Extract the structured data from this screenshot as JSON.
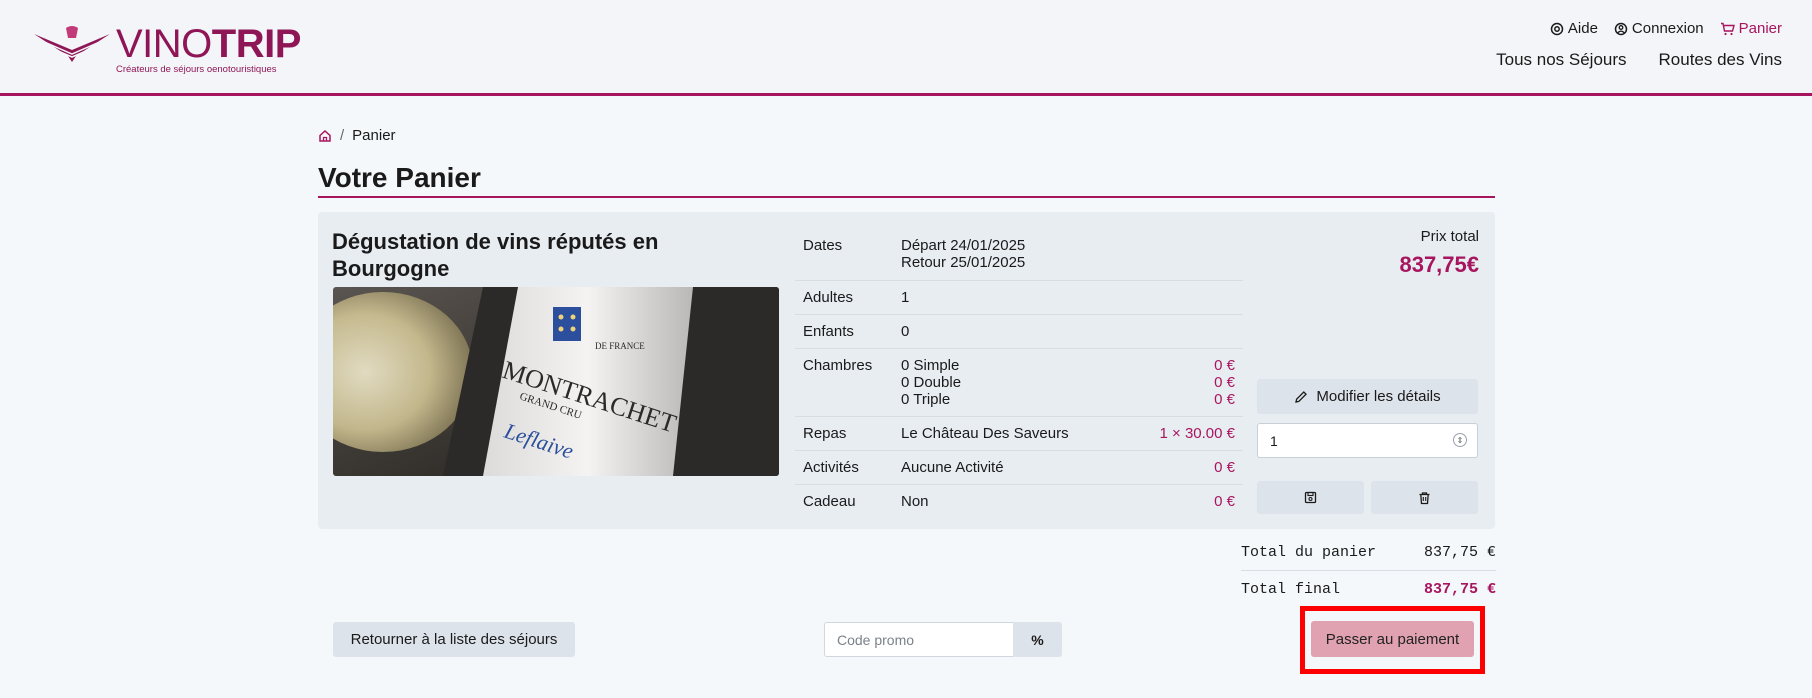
{
  "logo": {
    "word_light": "VINO",
    "word_bold": "TRIP",
    "tagline": "Créateurs de séjours oenotouristiques"
  },
  "topnav": {
    "help": "Aide",
    "login": "Connexion",
    "cart": "Panier"
  },
  "mainnav": {
    "stays": "Tous nos Séjours",
    "routes": "Routes des Vins"
  },
  "breadcrumb": {
    "current": "Panier"
  },
  "page": {
    "title": "Votre Panier"
  },
  "item": {
    "title": "Dégustation de vins réputés en Bourgogne",
    "image_alt": "MONTRACHET GRAND CRU",
    "details": [
      {
        "label": "Dates",
        "lines": [
          "Départ 24/01/2025",
          "Retour 25/01/2025"
        ],
        "prices": []
      },
      {
        "label": "Adultes",
        "lines": [
          "1"
        ],
        "prices": []
      },
      {
        "label": "Enfants",
        "lines": [
          "0"
        ],
        "prices": []
      },
      {
        "label": "Chambres",
        "lines": [
          "0 Simple",
          "0 Double",
          "0 Triple"
        ],
        "prices": [
          "0 €",
          "0 €",
          "0 €"
        ]
      },
      {
        "label": "Repas",
        "lines": [
          "Le Château Des Saveurs"
        ],
        "prices": [
          "1 × 30.00 €"
        ]
      },
      {
        "label": "Activités",
        "lines": [
          "Aucune Activité"
        ],
        "prices": [
          "0 €"
        ]
      },
      {
        "label": "Cadeau",
        "lines": [
          "Non"
        ],
        "prices": [
          "0 €"
        ]
      }
    ],
    "price_label": "Prix total",
    "price_value": "837,75€",
    "modify_label": "Modifier les détails",
    "quantity": "1"
  },
  "totals": {
    "cart_label": "Total du panier",
    "cart_value": "837,75 €",
    "final_label": "Total final",
    "final_value": "837,75 €"
  },
  "actions": {
    "back_label": "Retourner à la liste des séjours",
    "promo_placeholder": "Code promo",
    "promo_button": "%",
    "pay_label": "Passer au paiement"
  },
  "colors": {
    "accent": "#a8155f",
    "highlight": "#ff0000",
    "pay_button": "#e0a1b0"
  }
}
